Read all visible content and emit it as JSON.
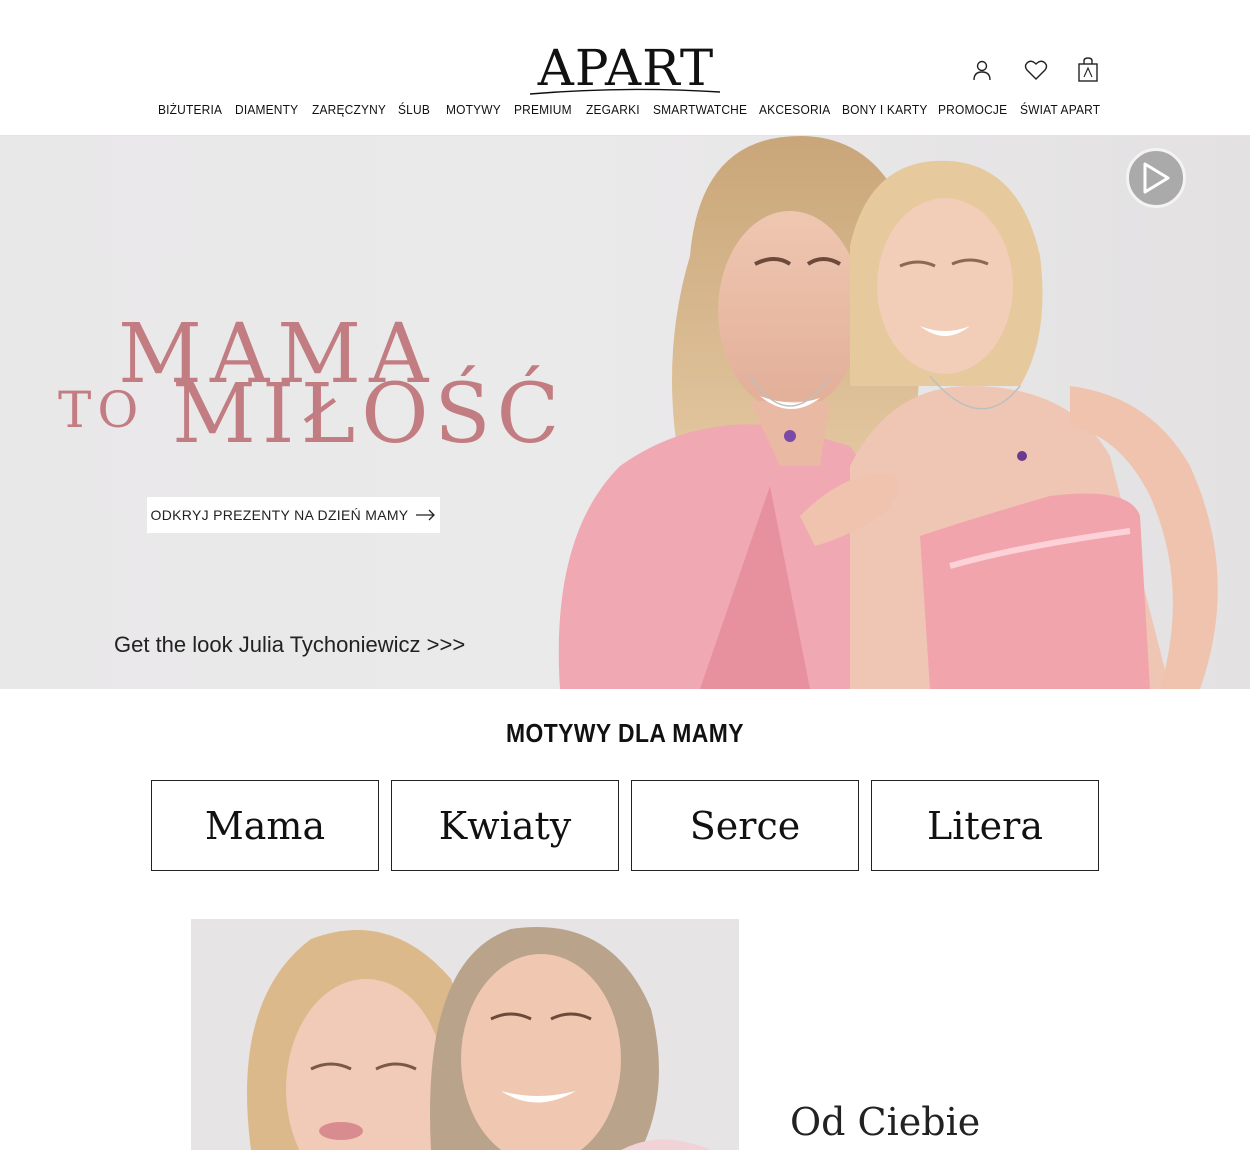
{
  "brand": {
    "logo_text": "APART"
  },
  "header_icons": [
    {
      "name": "user-icon"
    },
    {
      "name": "heart-icon"
    },
    {
      "name": "shopping-bag-icon"
    }
  ],
  "nav": {
    "items": [
      "BIŻUTERIA",
      "DIAMENTY",
      "ZARĘCZYNY",
      "ŚLUB",
      "MOTYWY",
      "PREMIUM",
      "ZEGARKI",
      "SMARTWATCHE",
      "AKCESORIA",
      "BONY I KARTY",
      "PROMOCJE",
      "ŚWIAT APART"
    ]
  },
  "hero": {
    "title_line1": "MAMA",
    "title_line2_small": "TO",
    "title_line2_large": "MIŁOŚĆ",
    "cta_label": "ODKRYJ PREZENTY NA DZIEŃ MAMY",
    "link_text": "Get the look Julia Tychoniewicz >>>",
    "accent_color": "#c27d82"
  },
  "motifs": {
    "title": "MOTYWY DLA MAMY",
    "items": [
      "Mama",
      "Kwiaty",
      "Serce",
      "Litera"
    ]
  },
  "lower": {
    "heading": "Od Ciebie"
  }
}
